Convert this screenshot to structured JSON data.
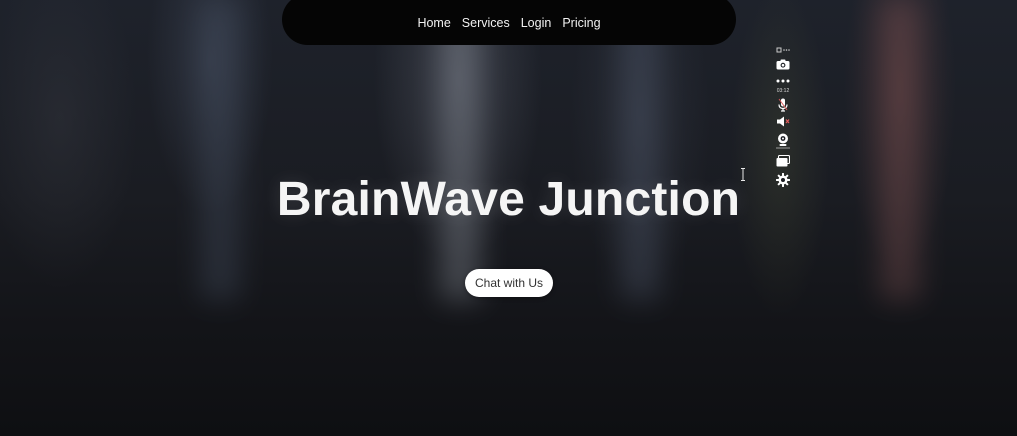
{
  "nav": {
    "items": [
      {
        "label": "Home"
      },
      {
        "label": "Services"
      },
      {
        "label": "Login"
      },
      {
        "label": "Pricing"
      }
    ]
  },
  "hero": {
    "title": "BrainWave Junction",
    "cta_label": "Chat with Us"
  },
  "recorder_toolbar": {
    "timer": "03:12",
    "icons": [
      "screenshot-camera-icon",
      "more-dots-icon",
      "microphone-icon",
      "speaker-icon",
      "webcam-icon",
      "screen-share-icon",
      "gear-icon"
    ]
  },
  "colors": {
    "nav_background": "#050505",
    "title_text": "#f5f5f5",
    "cta_background": "#ffffff"
  }
}
